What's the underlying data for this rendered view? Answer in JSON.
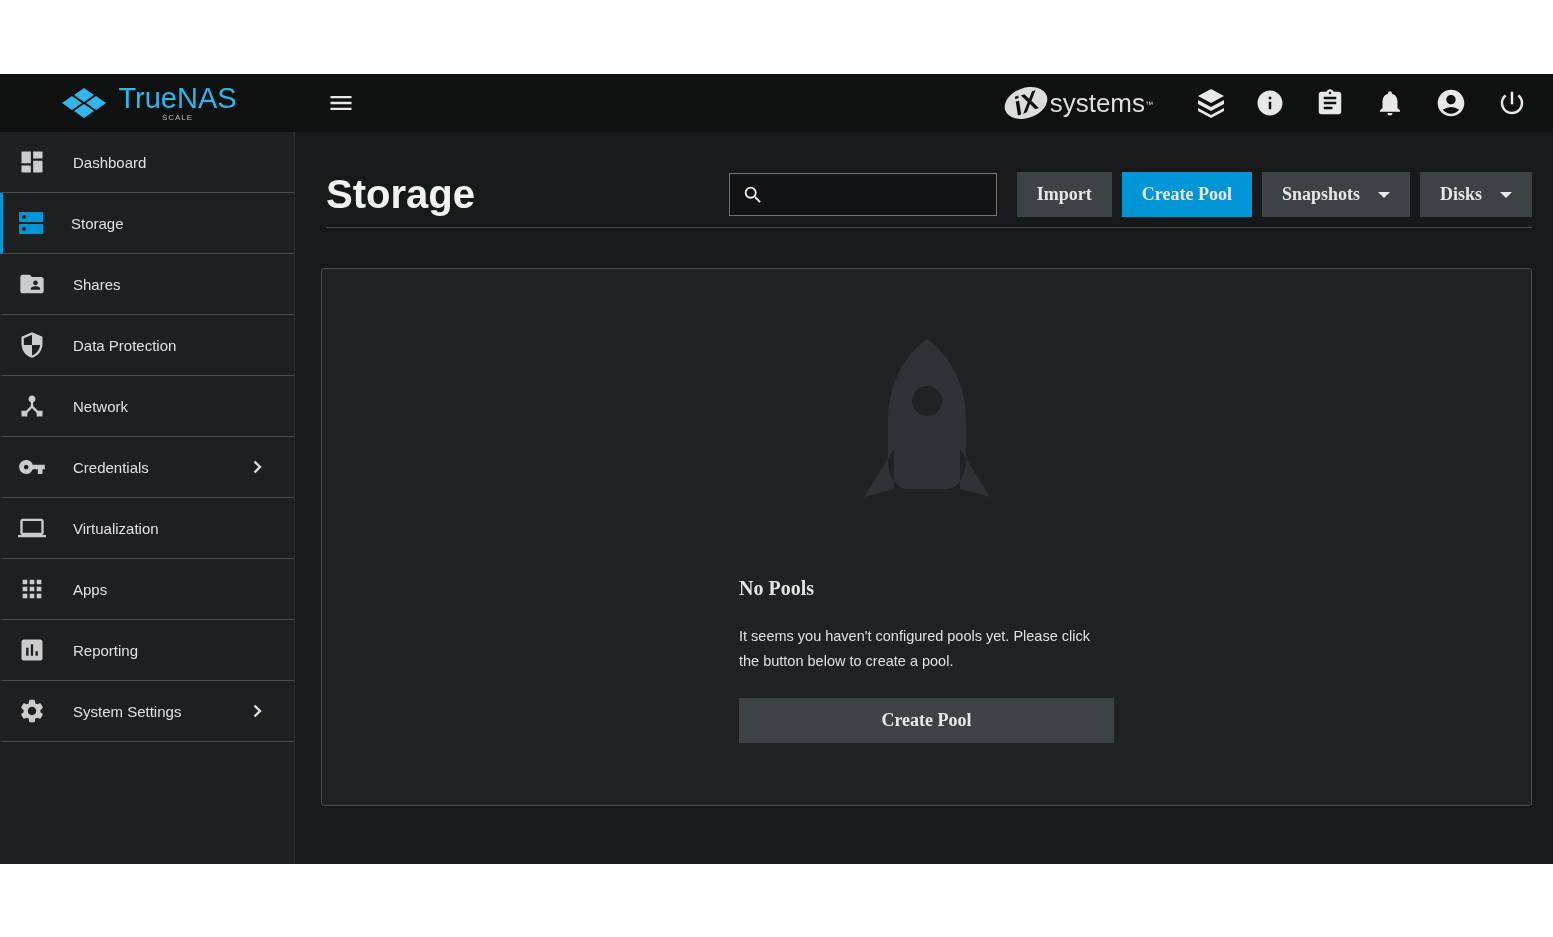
{
  "header": {
    "logo": {
      "name": "TrueNAS",
      "edition": "SCALE"
    },
    "brand": {
      "mark": "iX",
      "name": "systems",
      "tm": "™"
    }
  },
  "sidebar": {
    "items": [
      {
        "label": "Dashboard",
        "selected": false,
        "has_submenu": false
      },
      {
        "label": "Storage",
        "selected": true,
        "has_submenu": false
      },
      {
        "label": "Shares",
        "selected": false,
        "has_submenu": false
      },
      {
        "label": "Data Protection",
        "selected": false,
        "has_submenu": false
      },
      {
        "label": "Network",
        "selected": false,
        "has_submenu": false
      },
      {
        "label": "Credentials",
        "selected": false,
        "has_submenu": true
      },
      {
        "label": "Virtualization",
        "selected": false,
        "has_submenu": false
      },
      {
        "label": "Apps",
        "selected": false,
        "has_submenu": false
      },
      {
        "label": "Reporting",
        "selected": false,
        "has_submenu": false
      },
      {
        "label": "System Settings",
        "selected": false,
        "has_submenu": true
      }
    ]
  },
  "page": {
    "title": "Storage",
    "toolbar": [
      {
        "label": "Import",
        "kind": "plain"
      },
      {
        "label": "Create Pool",
        "kind": "primary"
      },
      {
        "label": "Snapshots",
        "kind": "dropdown"
      },
      {
        "label": "Disks",
        "kind": "dropdown"
      }
    ],
    "empty_state": {
      "title": "No Pools",
      "message": "It seems you haven't configured pools yet. Please click the button below to create a pool.",
      "button": "Create Pool"
    }
  }
}
